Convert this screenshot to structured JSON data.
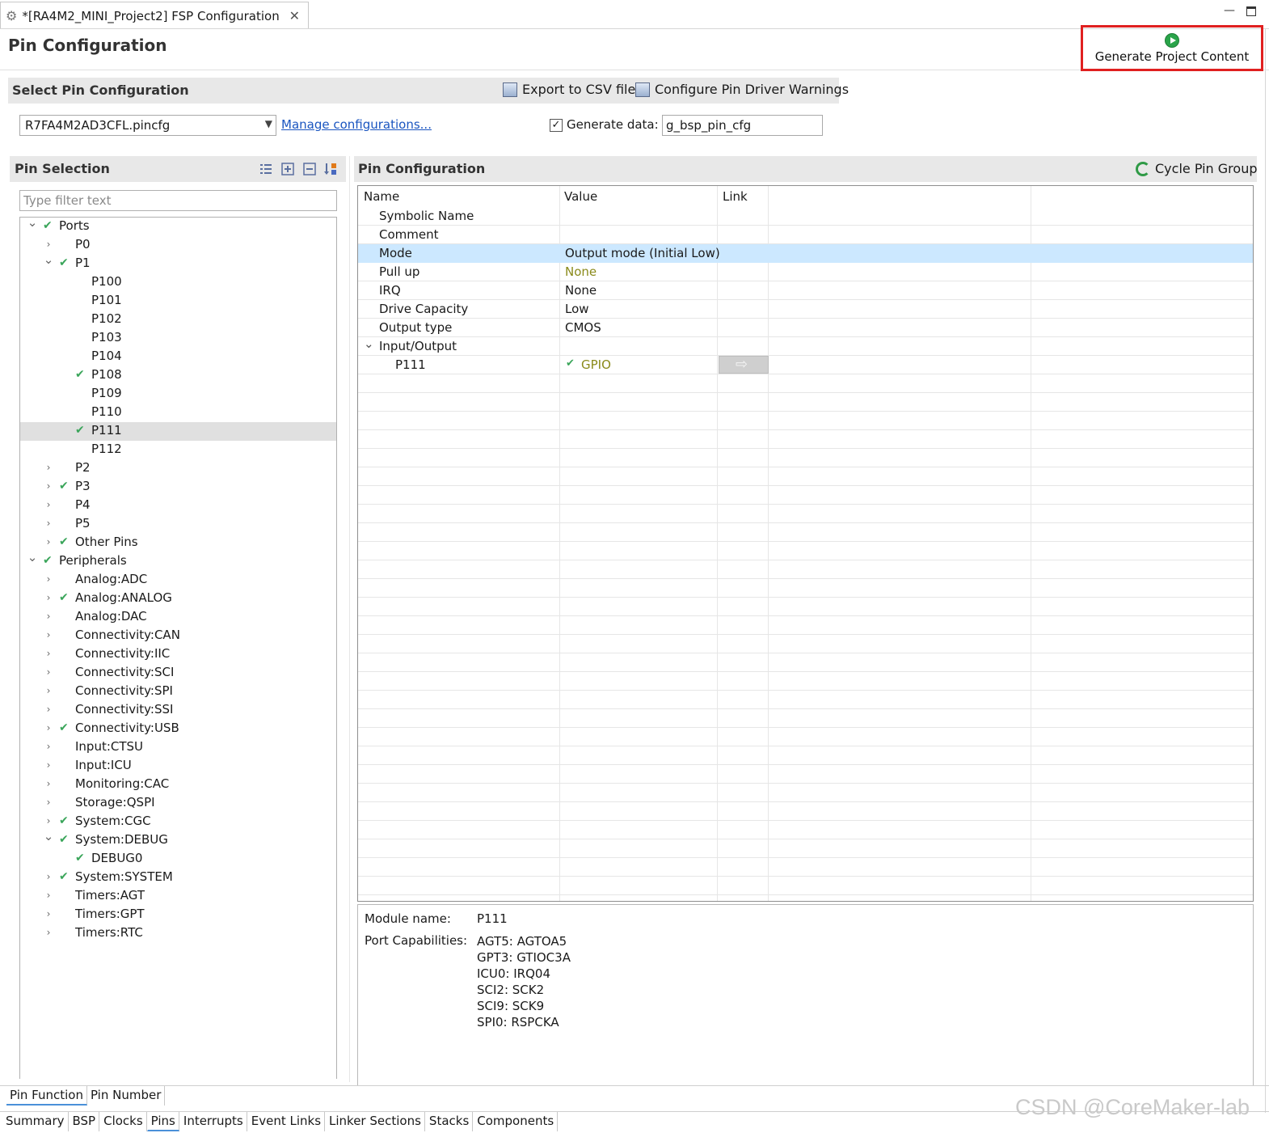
{
  "window": {
    "tab_title": "*[RA4M2_MINI_Project2] FSP Configuration",
    "minimize_glyph": "—"
  },
  "page": {
    "title": "Pin Configuration",
    "generate_label": "Generate Project Content"
  },
  "select_config": {
    "title": "Select Pin Configuration",
    "export_label": "Export to CSV file",
    "warnings_label": "Configure Pin Driver Warnings",
    "selected_file": "R7FA4M2AD3CFL.pincfg",
    "manage_label": "Manage configurations...",
    "generate_data_checked": true,
    "generate_data_label": "Generate data:",
    "generate_data_value": "g_bsp_pin_cfg"
  },
  "pin_selection": {
    "title": "Pin Selection",
    "filter_placeholder": "Type filter text",
    "tree": [
      {
        "label": "Ports",
        "depth": 0,
        "expandable": true,
        "expanded": true,
        "checked": true
      },
      {
        "label": "P0",
        "depth": 1,
        "expandable": true,
        "expanded": false,
        "checked": false
      },
      {
        "label": "P1",
        "depth": 1,
        "expandable": true,
        "expanded": true,
        "checked": true
      },
      {
        "label": "P100",
        "depth": 2,
        "expandable": false,
        "checked": false
      },
      {
        "label": "P101",
        "depth": 2,
        "expandable": false,
        "checked": false
      },
      {
        "label": "P102",
        "depth": 2,
        "expandable": false,
        "checked": false
      },
      {
        "label": "P103",
        "depth": 2,
        "expandable": false,
        "checked": false
      },
      {
        "label": "P104",
        "depth": 2,
        "expandable": false,
        "checked": false
      },
      {
        "label": "P108",
        "depth": 2,
        "expandable": false,
        "checked": true
      },
      {
        "label": "P109",
        "depth": 2,
        "expandable": false,
        "checked": false
      },
      {
        "label": "P110",
        "depth": 2,
        "expandable": false,
        "checked": false
      },
      {
        "label": "P111",
        "depth": 2,
        "expandable": false,
        "checked": true,
        "selected": true
      },
      {
        "label": "P112",
        "depth": 2,
        "expandable": false,
        "checked": false
      },
      {
        "label": "P2",
        "depth": 1,
        "expandable": true,
        "expanded": false,
        "checked": false
      },
      {
        "label": "P3",
        "depth": 1,
        "expandable": true,
        "expanded": false,
        "checked": true
      },
      {
        "label": "P4",
        "depth": 1,
        "expandable": true,
        "expanded": false,
        "checked": false
      },
      {
        "label": "P5",
        "depth": 1,
        "expandable": true,
        "expanded": false,
        "checked": false
      },
      {
        "label": "Other Pins",
        "depth": 1,
        "expandable": true,
        "expanded": false,
        "checked": true
      },
      {
        "label": "Peripherals",
        "depth": 0,
        "expandable": true,
        "expanded": true,
        "checked": true
      },
      {
        "label": "Analog:ADC",
        "depth": 1,
        "expandable": true,
        "expanded": false,
        "checked": false
      },
      {
        "label": "Analog:ANALOG",
        "depth": 1,
        "expandable": true,
        "expanded": false,
        "checked": true
      },
      {
        "label": "Analog:DAC",
        "depth": 1,
        "expandable": true,
        "expanded": false,
        "checked": false
      },
      {
        "label": "Connectivity:CAN",
        "depth": 1,
        "expandable": true,
        "expanded": false,
        "checked": false
      },
      {
        "label": "Connectivity:IIC",
        "depth": 1,
        "expandable": true,
        "expanded": false,
        "checked": false
      },
      {
        "label": "Connectivity:SCI",
        "depth": 1,
        "expandable": true,
        "expanded": false,
        "checked": false
      },
      {
        "label": "Connectivity:SPI",
        "depth": 1,
        "expandable": true,
        "expanded": false,
        "checked": false
      },
      {
        "label": "Connectivity:SSI",
        "depth": 1,
        "expandable": true,
        "expanded": false,
        "checked": false
      },
      {
        "label": "Connectivity:USB",
        "depth": 1,
        "expandable": true,
        "expanded": false,
        "checked": true
      },
      {
        "label": "Input:CTSU",
        "depth": 1,
        "expandable": true,
        "expanded": false,
        "checked": false
      },
      {
        "label": "Input:ICU",
        "depth": 1,
        "expandable": true,
        "expanded": false,
        "checked": false
      },
      {
        "label": "Monitoring:CAC",
        "depth": 1,
        "expandable": true,
        "expanded": false,
        "checked": false
      },
      {
        "label": "Storage:QSPI",
        "depth": 1,
        "expandable": true,
        "expanded": false,
        "checked": false
      },
      {
        "label": "System:CGC",
        "depth": 1,
        "expandable": true,
        "expanded": false,
        "checked": true
      },
      {
        "label": "System:DEBUG",
        "depth": 1,
        "expandable": true,
        "expanded": true,
        "checked": true
      },
      {
        "label": "DEBUG0",
        "depth": 2,
        "expandable": false,
        "checked": true
      },
      {
        "label": "System:SYSTEM",
        "depth": 1,
        "expandable": true,
        "expanded": false,
        "checked": true
      },
      {
        "label": "Timers:AGT",
        "depth": 1,
        "expandable": true,
        "expanded": false,
        "checked": false
      },
      {
        "label": "Timers:GPT",
        "depth": 1,
        "expandable": true,
        "expanded": false,
        "checked": false
      },
      {
        "label": "Timers:RTC",
        "depth": 1,
        "expandable": true,
        "expanded": false,
        "checked": false
      }
    ]
  },
  "pin_config": {
    "title": "Pin Configuration",
    "cycle_label": "Cycle Pin Group",
    "columns": [
      "Name",
      "Value",
      "Link"
    ],
    "rows": [
      {
        "name": "Symbolic Name",
        "value": "",
        "depth": 1
      },
      {
        "name": "Comment",
        "value": "",
        "depth": 1
      },
      {
        "name": "Mode",
        "value": "Output mode (Initial Low)",
        "depth": 1,
        "highlighted": true
      },
      {
        "name": "Pull up",
        "value": "None",
        "depth": 1,
        "value_style": "olive"
      },
      {
        "name": "IRQ",
        "value": "None",
        "depth": 1
      },
      {
        "name": "Drive Capacity",
        "value": "Low",
        "depth": 1
      },
      {
        "name": "Output type",
        "value": "CMOS",
        "depth": 1
      },
      {
        "name": "Input/Output",
        "value": "",
        "depth": 1,
        "expandable": true
      },
      {
        "name": "P111",
        "value": "GPIO",
        "depth": 2,
        "value_style": "olive",
        "checked": true,
        "link": true
      }
    ]
  },
  "info": {
    "module_label": "Module name:",
    "module_value": "P111",
    "capabilities_label": "Port Capabilities:",
    "capabilities": [
      "AGT5: AGTOA5",
      "GPT3: GTIOC3A",
      "ICU0: IRQ04",
      "SCI2: SCK2",
      "SCI9: SCK9",
      "SPI0: RSPCKA"
    ]
  },
  "sub_tabs": [
    {
      "label": "Pin Function",
      "active": true
    },
    {
      "label": "Pin Number",
      "active": false
    }
  ],
  "main_tabs": [
    {
      "label": "Summary",
      "active": false
    },
    {
      "label": "BSP",
      "active": false
    },
    {
      "label": "Clocks",
      "active": false
    },
    {
      "label": "Pins",
      "active": true
    },
    {
      "label": "Interrupts",
      "active": false
    },
    {
      "label": "Event Links",
      "active": false
    },
    {
      "label": "Linker Sections",
      "active": false
    },
    {
      "label": "Stacks",
      "active": false
    },
    {
      "label": "Components",
      "active": false
    }
  ],
  "watermark": "CSDN @CoreMaker-lab",
  "colors": {
    "check": "#3aa55a",
    "highlight_row": "#cce8ff",
    "generate_border": "#e02020",
    "link": "#1a55c0",
    "olive_value": "#8a8a1a"
  }
}
